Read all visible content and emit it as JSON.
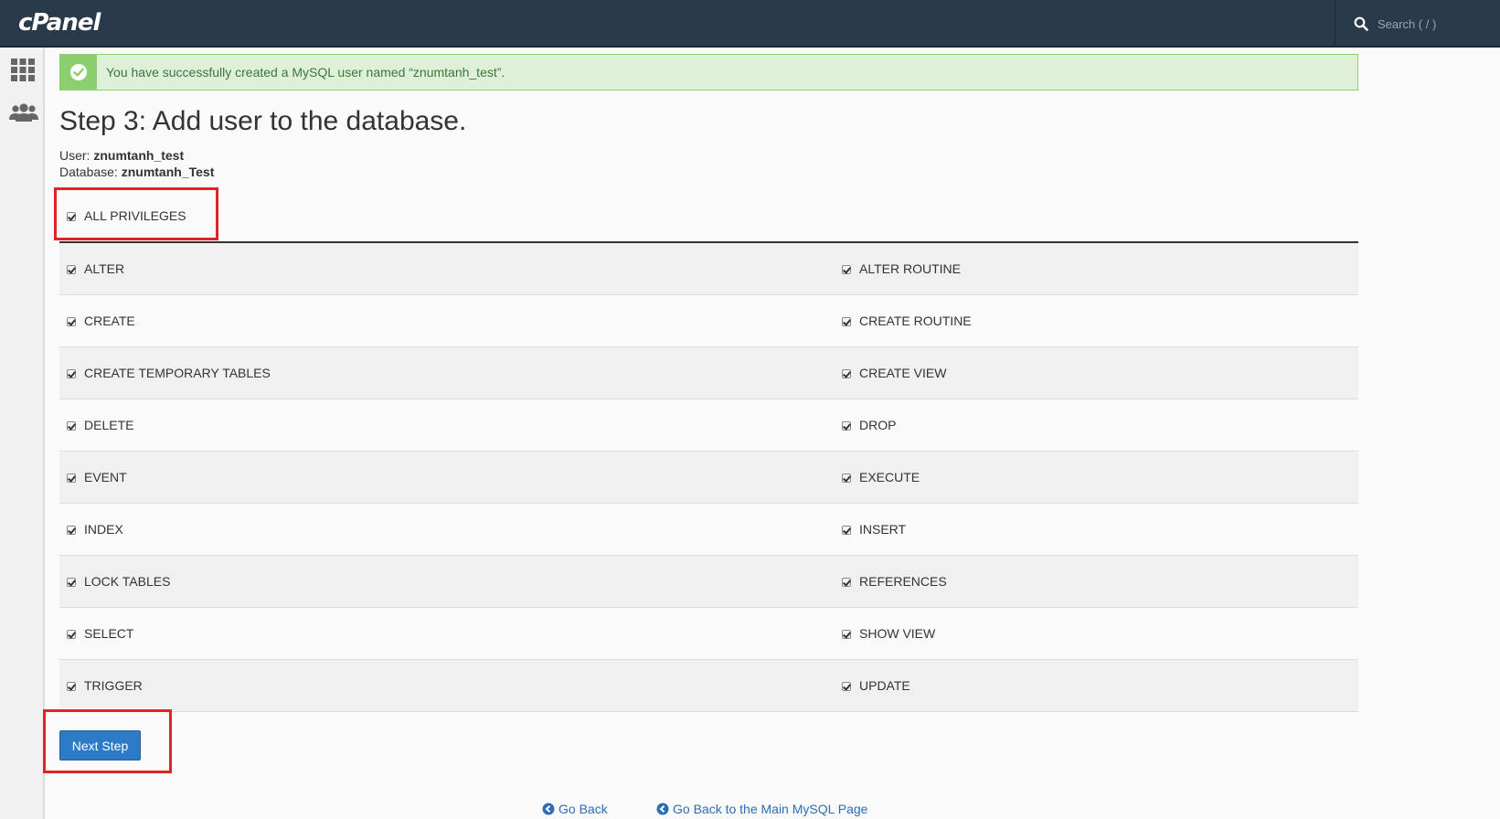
{
  "header": {
    "logo_text": "cPanel",
    "search_placeholder": "Search ( / )"
  },
  "sidebar": {
    "items": [
      {
        "icon": "grid-icon"
      },
      {
        "icon": "users-icon"
      }
    ]
  },
  "alert": {
    "text": "You have successfully created a MySQL user named “znumtanh_test”."
  },
  "page": {
    "title": "Step 3: Add user to the database.",
    "user_label": "User:",
    "user_value": "znumtanh_test",
    "database_label": "Database:",
    "database_value": "znumtanh_Test"
  },
  "privileges": {
    "all_label": "ALL PRIVILEGES",
    "all_checked": true,
    "rows": [
      {
        "left": "ALTER",
        "right": "ALTER ROUTINE"
      },
      {
        "left": "CREATE",
        "right": "CREATE ROUTINE"
      },
      {
        "left": "CREATE TEMPORARY TABLES",
        "right": "CREATE VIEW"
      },
      {
        "left": "DELETE",
        "right": "DROP"
      },
      {
        "left": "EVENT",
        "right": "EXECUTE"
      },
      {
        "left": "INDEX",
        "right": "INSERT"
      },
      {
        "left": "LOCK TABLES",
        "right": "REFERENCES"
      },
      {
        "left": "SELECT",
        "right": "SHOW VIEW"
      },
      {
        "left": "TRIGGER",
        "right": "UPDATE"
      }
    ]
  },
  "actions": {
    "next_label": "Next Step",
    "go_back_label": "Go Back",
    "main_mysql_label": "Go Back to the Main MySQL Page"
  },
  "colors": {
    "topbar": "#293a4a",
    "success_border": "#8ccf6e",
    "button_blue": "#2d7bc6",
    "highlight_red": "#e0222b"
  }
}
